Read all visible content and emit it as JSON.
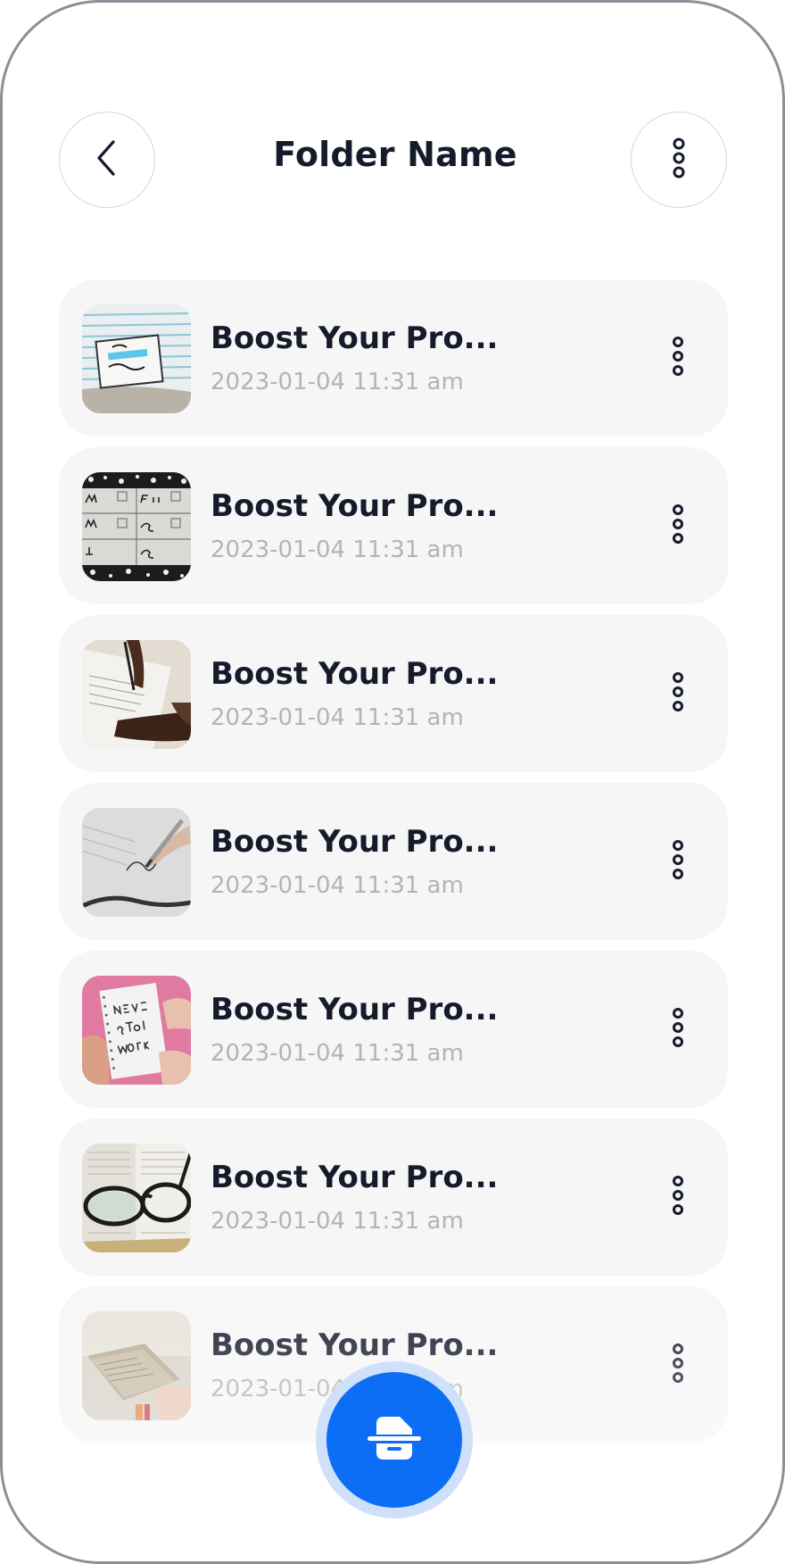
{
  "header": {
    "title": "Folder Name",
    "back_icon": "chevron-left-icon",
    "menu_icon": "more-vertical-icon"
  },
  "items": [
    {
      "title": "Boost Your Pro...",
      "date": "2023-01-04 11:31 am",
      "thumbnail": "notebook-make-it-happen"
    },
    {
      "title": "Boost Your Pro...",
      "date": "2023-01-04 11:31 am",
      "thumbnail": "weekly-planner"
    },
    {
      "title": "Boost Your Pro...",
      "date": "2023-01-04 11:31 am",
      "thumbnail": "hands-signing-paper"
    },
    {
      "title": "Boost Your Pro...",
      "date": "2023-01-04 11:31 am",
      "thumbnail": "pen-writing-signature"
    },
    {
      "title": "Boost Your Pro...",
      "date": "2023-01-04 11:31 am",
      "thumbnail": "never-stop-working-notebook"
    },
    {
      "title": "Boost Your Pro...",
      "date": "2023-01-04 11:31 am",
      "thumbnail": "glasses-on-book"
    },
    {
      "title": "Boost Your Pro...",
      "date": "2023-01-04 11:31 am",
      "thumbnail": "open-book"
    }
  ],
  "fab": {
    "icon": "scanner-icon"
  },
  "colors": {
    "accent": "#0b6ef5",
    "accent_ring": "#cfe0fb",
    "card_bg": "#f6f6f7",
    "title_text": "#161b2c",
    "date_text": "#b3b3b8"
  }
}
